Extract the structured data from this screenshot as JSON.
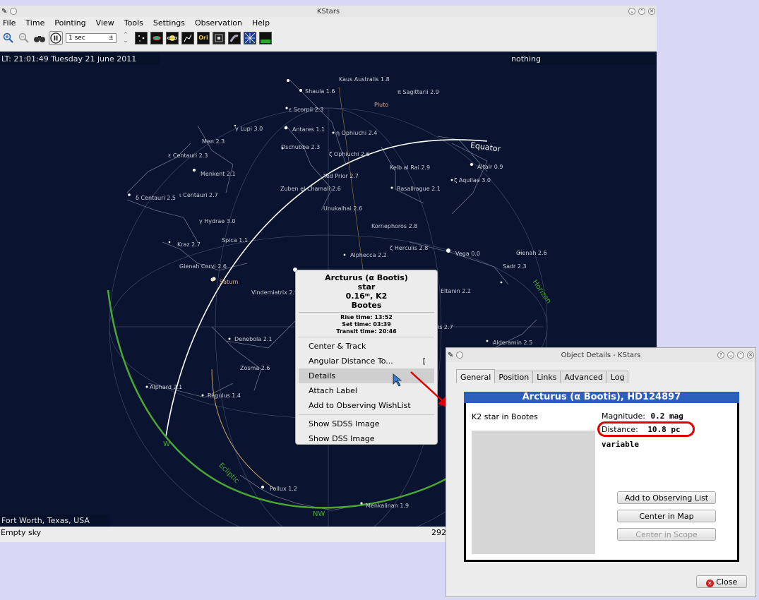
{
  "main": {
    "title": "KStars",
    "menu": [
      "File",
      "Time",
      "Pointing",
      "View",
      "Tools",
      "Settings",
      "Observation",
      "Help"
    ],
    "time_step": "1 sec",
    "lt": "LT: 21:01:49   Tuesday 21 june 2011",
    "focus": "nothing",
    "location": "Fort Worth, Texas, USA",
    "status": "Empty sky",
    "status_right": "292"
  },
  "sky_labels": {
    "equator": "Equator",
    "horizon": "Horizon",
    "ecliptic": "Ecliptic",
    "w": "W",
    "nw": "NW",
    "saturn": "Saturn",
    "pluto": "Pluto"
  },
  "stars": [
    "Kaus Australis 1.8",
    "Shaula 1.6",
    "π Sagittarii 2.9",
    "ε Scorpii 2.3",
    "γ Lupi 3.0",
    "Antares 1.1",
    "η Ophiuchi 2.4",
    "Men 2.3",
    "Dschubba 2.3",
    "ζ Ophiuchi 2.6",
    "ε Centauri 2.3",
    "Kelb al Rai 2.9",
    "Altair 0.9",
    "Menkent 2.1",
    "Yed Prior 2.7",
    "ζ Aquilae 3.0",
    "δ Centauri 2.5",
    "ι Centauri 2.7",
    "Zuben el Chamali 2.6",
    "Rasalhague 2.1",
    "Unukalhai 2.6",
    "γ Hydrae 3.0",
    "Kornephoros 2.8",
    "Spica 1.1",
    "ζ Herculis 2.8",
    "Kraz 2.7",
    "Alphecca 2.2",
    "Vega 0.0",
    "Gienah 2.6",
    "Gienah Corvi 2.6",
    "Sadr 2.3",
    "Vindemiatrix 2.9",
    "Eltanin 2.2",
    "Denebola 2.1",
    "Zosma 2.6",
    "Alphard 2.1",
    "Regulus 1.4",
    "Pollux 1.2",
    "Menkalinan 1.9",
    "Alderamin 2.5",
    "is 2.7"
  ],
  "context_menu": {
    "name": "Arcturus (α Bootis)",
    "type": "star",
    "mag": "0.16ᵐ, K2",
    "constellation": "Bootes",
    "rise": "Rise time: 13:52",
    "set": "Set time: 03:39",
    "transit": "Transit time: 20:46",
    "items": [
      "Center & Track",
      "Angular Distance To...",
      "Details",
      "Attach Label",
      "Add to Observing WishList",
      "Show SDSS Image",
      "Show DSS Image"
    ],
    "shortcut": "["
  },
  "details": {
    "title": "Object Details - KStars",
    "tabs": [
      "General",
      "Position",
      "Links",
      "Advanced",
      "Log"
    ],
    "header": "Arcturus (α Bootis), HD124897",
    "desc": "K2 star in Bootes",
    "mag_label": "Magnitude:",
    "mag_value": "0.2 mag",
    "dist_label": "Distance:",
    "dist_value": "10.8 pc",
    "variable": "variable",
    "btn_add": "Add to Observing List",
    "btn_center_map": "Center in Map",
    "btn_center_scope": "Center in Scope",
    "btn_close": "Close"
  },
  "colors": {
    "sky": "#0a1330",
    "equator": "#ffffff",
    "horizon": "#4aa832",
    "highlight": "#e00000",
    "dlg_header": "#2a60bc"
  }
}
